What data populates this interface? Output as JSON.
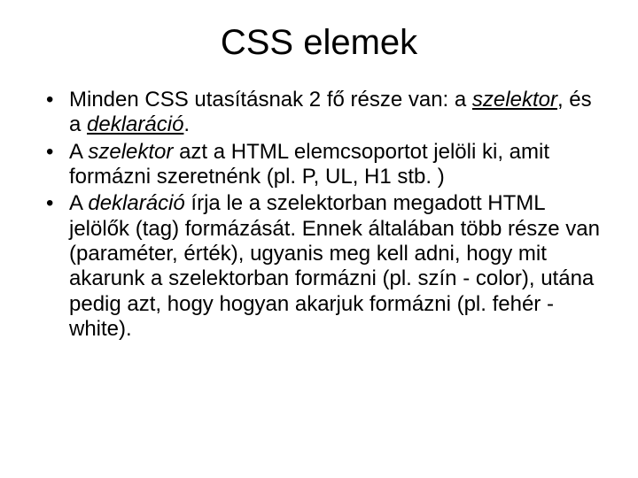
{
  "title": "CSS elemek",
  "bullets": {
    "b1": {
      "t1": "Minden CSS utasításnak 2 fő része van: a ",
      "szelektor": "szelektor",
      "comma": ", és a ",
      "deklaracio": "deklaráció",
      "period": "."
    },
    "b2": {
      "t1": "A ",
      "szelektor": "szelektor",
      "t2": " azt a HTML elemcsoportot jelöli ki, amit formázni szeretnénk (pl. P, UL, H1 stb. )"
    },
    "b3": {
      "t1": "A ",
      "deklaracio": "deklaráció",
      "t2": " írja le a szelektorban megadott HTML jelölők (tag) formázását. Ennek általában több része van (paraméter, érték), ugyanis meg kell adni, hogy mit akarunk a szelektorban formázni (pl. szín - color), utána pedig azt, hogy hogyan akarjuk formázni (pl. fehér - white)."
    }
  }
}
